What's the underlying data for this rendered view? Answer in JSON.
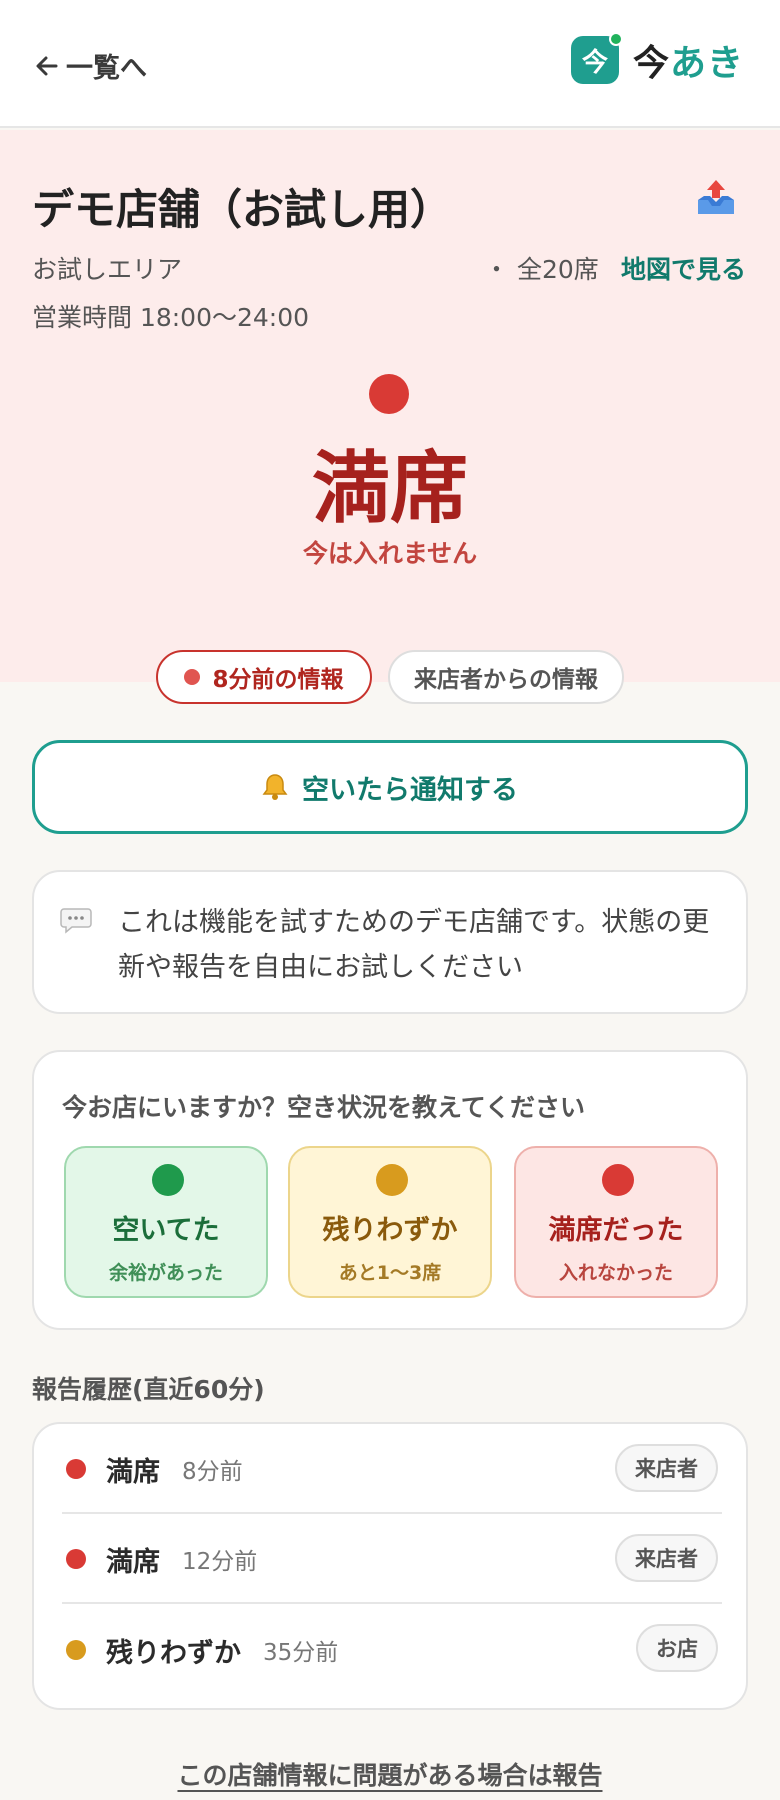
{
  "header": {
    "back_label": "一覧へ",
    "logo_badge": "今",
    "logo_part1": "今",
    "logo_part2": "あき"
  },
  "store": {
    "name": "デモ店舗（お試し用）",
    "area": "お試しエリア",
    "seats": "・ 全20席",
    "map_link": "地図で見る",
    "hours": "営業時間 18:00〜24:00"
  },
  "status": {
    "label": "満席",
    "sub": "今は入れません",
    "color": "#d93a35"
  },
  "info_pills": {
    "age": "8分前の情報",
    "source": "来店者からの情報"
  },
  "notify_button": "空いたら通知する",
  "note": "これは機能を試すためのデモ店舗です。状態の更新や報告を自由にお試しください",
  "report": {
    "question": "今お店にいますか？空き状況を教えてください",
    "options": [
      {
        "title": "空いてた",
        "sub": "余裕があった",
        "color": "#1f9a4c"
      },
      {
        "title": "残りわずか",
        "sub": "あと1〜3席",
        "color": "#d89b1e"
      },
      {
        "title": "満席だった",
        "sub": "入れなかった",
        "color": "#d93a35"
      }
    ]
  },
  "history": {
    "title": "報告履歴(直近60分)",
    "items": [
      {
        "status": "満席",
        "time": "8分前",
        "source": "来店者",
        "color": "#d93a35"
      },
      {
        "status": "満席",
        "time": "12分前",
        "source": "来店者",
        "color": "#d93a35"
      },
      {
        "status": "残りわずか",
        "time": "35分前",
        "source": "お店",
        "color": "#d89b1e"
      }
    ]
  },
  "footer_link": "この店舗情報に問題がある場合は報告",
  "icons": [
    "back-arrow-icon",
    "share-icon",
    "bell-icon",
    "speech-bubble-icon"
  ]
}
